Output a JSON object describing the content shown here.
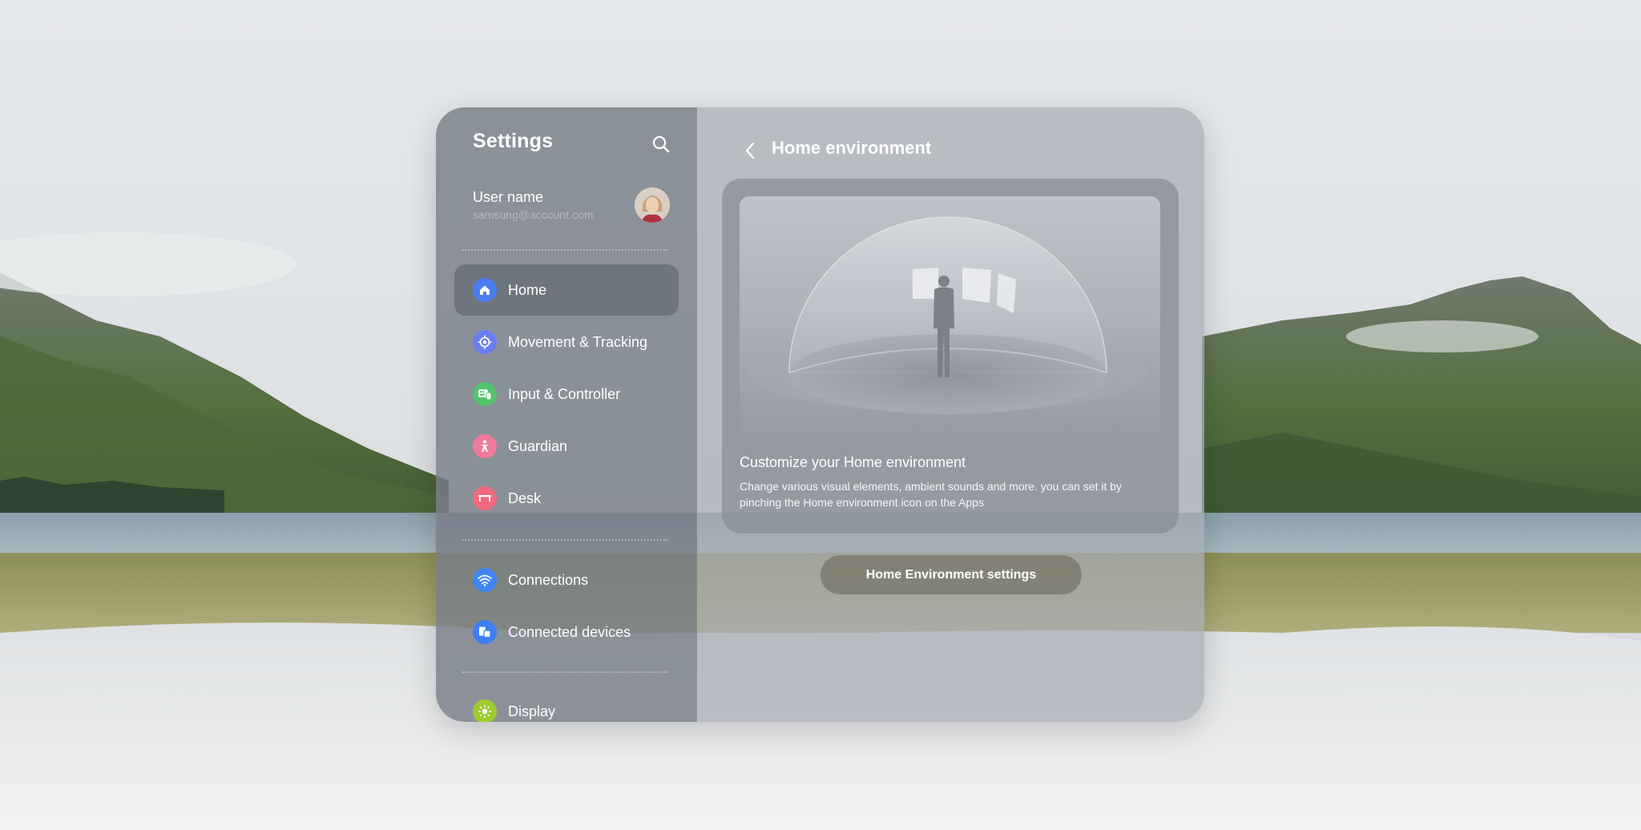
{
  "colors": {
    "home_icon": "#4a7cf0",
    "movement_icon": "#6a7ef0",
    "input_icon": "#54c36e",
    "guardian_icon": "#f07a9a",
    "desk_icon": "#f0697e",
    "connections_icon": "#3f86f2",
    "devices_icon": "#3f7ef2",
    "display_icon": "#9ccd2e"
  },
  "sidebar": {
    "title": "Settings",
    "search_icon": "search-icon",
    "user": {
      "name": "User name",
      "email": "samsung@account.com"
    },
    "items": [
      {
        "label": "Home",
        "icon": "home-icon",
        "active": true
      },
      {
        "label": "Movement & Tracking",
        "icon": "tracking-icon",
        "active": false
      },
      {
        "label": "Input & Controller",
        "icon": "controller-icon",
        "active": false
      },
      {
        "label": "Guardian",
        "icon": "guardian-icon",
        "active": false
      },
      {
        "label": "Desk",
        "icon": "desk-icon",
        "active": false
      },
      {
        "label": "Connections",
        "icon": "wifi-icon",
        "active": false
      },
      {
        "label": "Connected devices",
        "icon": "devices-icon",
        "active": false
      },
      {
        "label": "Display",
        "icon": "brightness-icon",
        "active": false
      }
    ]
  },
  "main": {
    "back_icon": "chevron-left-icon",
    "title": "Home environment",
    "card": {
      "heading": "Customize your Home environment",
      "description": "Change various visual elements, ambient sounds and more. you can set it by pinching the Home environment icon on the Apps"
    },
    "button_label": "Home Environment settings"
  }
}
